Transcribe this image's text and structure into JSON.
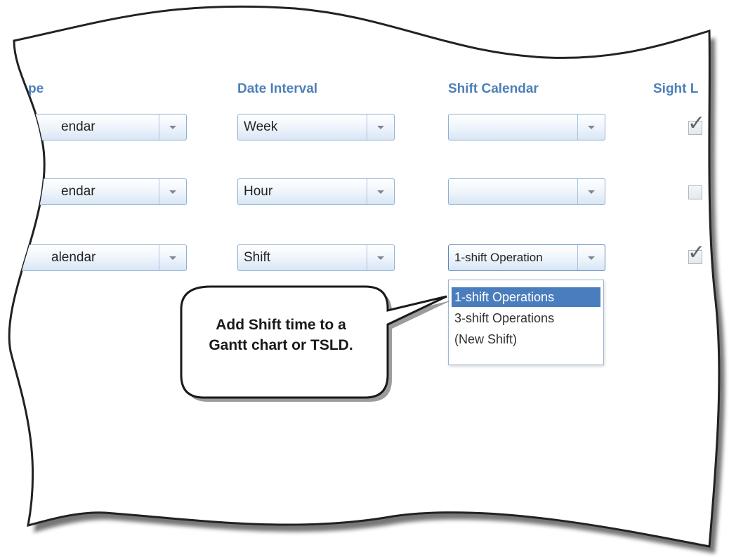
{
  "columns": {
    "type_header": "pe",
    "interval_header": "Date Interval",
    "shift_header": "Shift Calendar",
    "sight_header": "Sight L"
  },
  "rows": [
    {
      "type_value": "endar",
      "interval_value": "Week",
      "shift_value": "",
      "sight_checked": true
    },
    {
      "type_value": "endar",
      "interval_value": "Hour",
      "shift_value": "",
      "sight_checked": false
    },
    {
      "type_value": "alendar",
      "interval_value": "Shift",
      "shift_value": "1-shift Operation",
      "sight_checked": true
    }
  ],
  "shift_dropdown": {
    "options": [
      "1-shift Operations",
      "3-shift Operations",
      "(New Shift)"
    ],
    "selected": "1-shift Operations"
  },
  "callout": {
    "line1": "Add Shift time to a",
    "line2": "Gantt chart or TSLD."
  },
  "colors": {
    "header": "#4d7fb8",
    "selection": "#4a7dbd",
    "dropdown_border": "#8fb0d4"
  },
  "icons": {
    "dropdown_arrow": "chevron-down-icon",
    "checkmark": "checkmark-icon"
  }
}
